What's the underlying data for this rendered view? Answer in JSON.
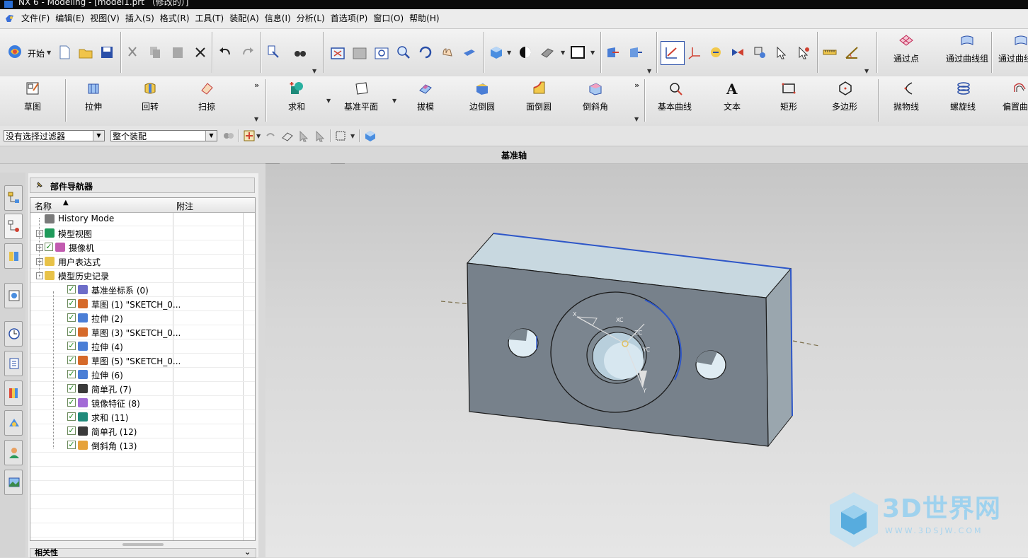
{
  "window": {
    "title": "NX 6 - Modeling - [model1.prt （修改的）]"
  },
  "menu": {
    "items": [
      "文件(F)",
      "编辑(E)",
      "视图(V)",
      "插入(S)",
      "格式(R)",
      "工具(T)",
      "装配(A)",
      "信息(I)",
      "分析(L)",
      "首选项(P)",
      "窗口(O)",
      "帮助(H)"
    ]
  },
  "toolbar1": {
    "start_label": "开始",
    "through_points": "通过点",
    "through_curve_mesh": "通过曲线组",
    "through_curves": "通过曲线"
  },
  "toolbar2": {
    "sketch": "草图",
    "extrude": "拉伸",
    "revolve": "回转",
    "sweep": "扫掠",
    "unite": "求和",
    "datum_plane": "基准平面",
    "draft": "拔模",
    "edge_blend": "边倒圆",
    "face_blend": "面倒圆",
    "chamfer": "倒斜角",
    "basic_curves": "基本曲线",
    "text": "文本",
    "rectangle": "矩形",
    "polygon": "多边形",
    "parabola": "抛物线",
    "helix": "螺旋线",
    "offset_curve": "偏置曲"
  },
  "selection_bar": {
    "filter_value": "没有选择过滤器",
    "scope_value": "整个装配"
  },
  "cue_line": "基准轴",
  "navigator": {
    "title": "部件导航器",
    "col_name": "名称",
    "col_note": "附注",
    "rows": [
      {
        "label": "History Mode",
        "indent": 0,
        "expander": "",
        "check": false,
        "icon": "clock-icon",
        "color": "#7a7a7a"
      },
      {
        "label": "模型视图",
        "indent": 0,
        "expander": "+",
        "check": false,
        "icon": "model-views-icon",
        "color": "#1f9a5a"
      },
      {
        "label": "摄像机",
        "indent": 0,
        "expander": "+",
        "check": true,
        "icon": "camera-icon",
        "color": "#c25bb0"
      },
      {
        "label": "用户表达式",
        "indent": 0,
        "expander": "+",
        "check": false,
        "icon": "folder-icon",
        "color": "#e8c248"
      },
      {
        "label": "模型历史记录",
        "indent": 0,
        "expander": "-",
        "check": false,
        "icon": "folder-open-icon",
        "color": "#e8c248"
      },
      {
        "label": "基准坐标系 (0)",
        "indent": 1,
        "expander": "",
        "check": true,
        "icon": "datum-csys-icon",
        "color": "#6d6dc8"
      },
      {
        "label": "草图 (1) \"SKETCH_0...",
        "indent": 1,
        "expander": "",
        "check": true,
        "icon": "sketch-icon",
        "color": "#d66a2a"
      },
      {
        "label": "拉伸 (2)",
        "indent": 1,
        "expander": "",
        "check": true,
        "icon": "extrude-icon",
        "color": "#4a7ed6"
      },
      {
        "label": "草图 (3) \"SKETCH_0...",
        "indent": 1,
        "expander": "",
        "check": true,
        "icon": "sketch-icon",
        "color": "#d66a2a"
      },
      {
        "label": "拉伸 (4)",
        "indent": 1,
        "expander": "",
        "check": true,
        "icon": "extrude-icon",
        "color": "#4a7ed6"
      },
      {
        "label": "草图 (5) \"SKETCH_0...",
        "indent": 1,
        "expander": "",
        "check": true,
        "icon": "sketch-icon",
        "color": "#d66a2a"
      },
      {
        "label": "拉伸 (6)",
        "indent": 1,
        "expander": "",
        "check": true,
        "icon": "extrude-icon",
        "color": "#4a7ed6"
      },
      {
        "label": "简单孔 (7)",
        "indent": 1,
        "expander": "",
        "check": true,
        "icon": "simple-hole-icon",
        "color": "#3a3a3a"
      },
      {
        "label": "镜像特征 (8)",
        "indent": 1,
        "expander": "",
        "check": true,
        "icon": "mirror-feature-icon",
        "color": "#a26ad6"
      },
      {
        "label": "求和 (11)",
        "indent": 1,
        "expander": "",
        "check": true,
        "icon": "unite-icon",
        "color": "#1f8a7a"
      },
      {
        "label": "简单孔 (12)",
        "indent": 1,
        "expander": "",
        "check": true,
        "icon": "simple-hole-icon",
        "color": "#3a3a3a"
      },
      {
        "label": "倒斜角 (13)",
        "indent": 1,
        "expander": "",
        "check": true,
        "icon": "chamfer-icon",
        "color": "#e6a23a"
      }
    ],
    "related_title": "相关性"
  },
  "graphics": {
    "csys_labels": {
      "x": "X",
      "xc": "XC",
      "zc": "ZC",
      "yc": "YC",
      "y": "Y"
    }
  },
  "watermark": {
    "brand": "3D世界网",
    "url": "WWW.3DSJW.COM"
  },
  "colors": {
    "accent": "#2d56c8",
    "part_face": "#7b8590",
    "part_top": "#c6d3db",
    "part_side": "#9ba6ae"
  }
}
